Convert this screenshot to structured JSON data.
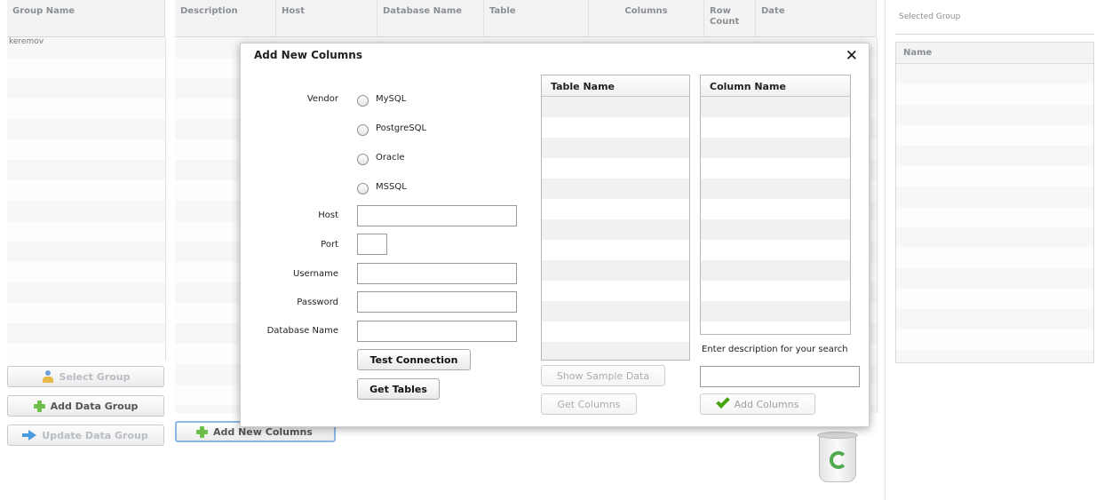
{
  "background": {
    "columns": [
      "Group Name",
      "Description",
      "Host",
      "Database Name",
      "Table",
      "Columns",
      "Row\nCount",
      "Date"
    ],
    "group_row_first": "keremov",
    "selected_group_label": "Selected Group",
    "selected_group_col": "Name",
    "buttons": {
      "select_group": "Select Group",
      "add_data_group": "Add Data Group",
      "update_data_group": "Update Data Group",
      "add_new_columns": "Add New Columns"
    }
  },
  "modal": {
    "title": "Add New Columns",
    "close": "✕",
    "vendor_label": "Vendor",
    "vendors": [
      "MySQL",
      "PostgreSQL",
      "Oracle",
      "MSSQL"
    ],
    "fields": {
      "host": {
        "label": "Host",
        "value": ""
      },
      "port": {
        "label": "Port",
        "value": ""
      },
      "username": {
        "label": "Username",
        "value": ""
      },
      "password": {
        "label": "Password",
        "value": ""
      },
      "database_name": {
        "label": "Database Name",
        "value": ""
      }
    },
    "buttons": {
      "test_connection": "Test Connection",
      "get_tables": "Get Tables",
      "show_sample_data": "Show Sample Data",
      "get_columns": "Get Columns",
      "add_columns": "Add Columns"
    },
    "table_list_header": "Table Name",
    "column_list_header": "Column Name",
    "search_prompt": "Enter description for your search",
    "search_value": ""
  }
}
